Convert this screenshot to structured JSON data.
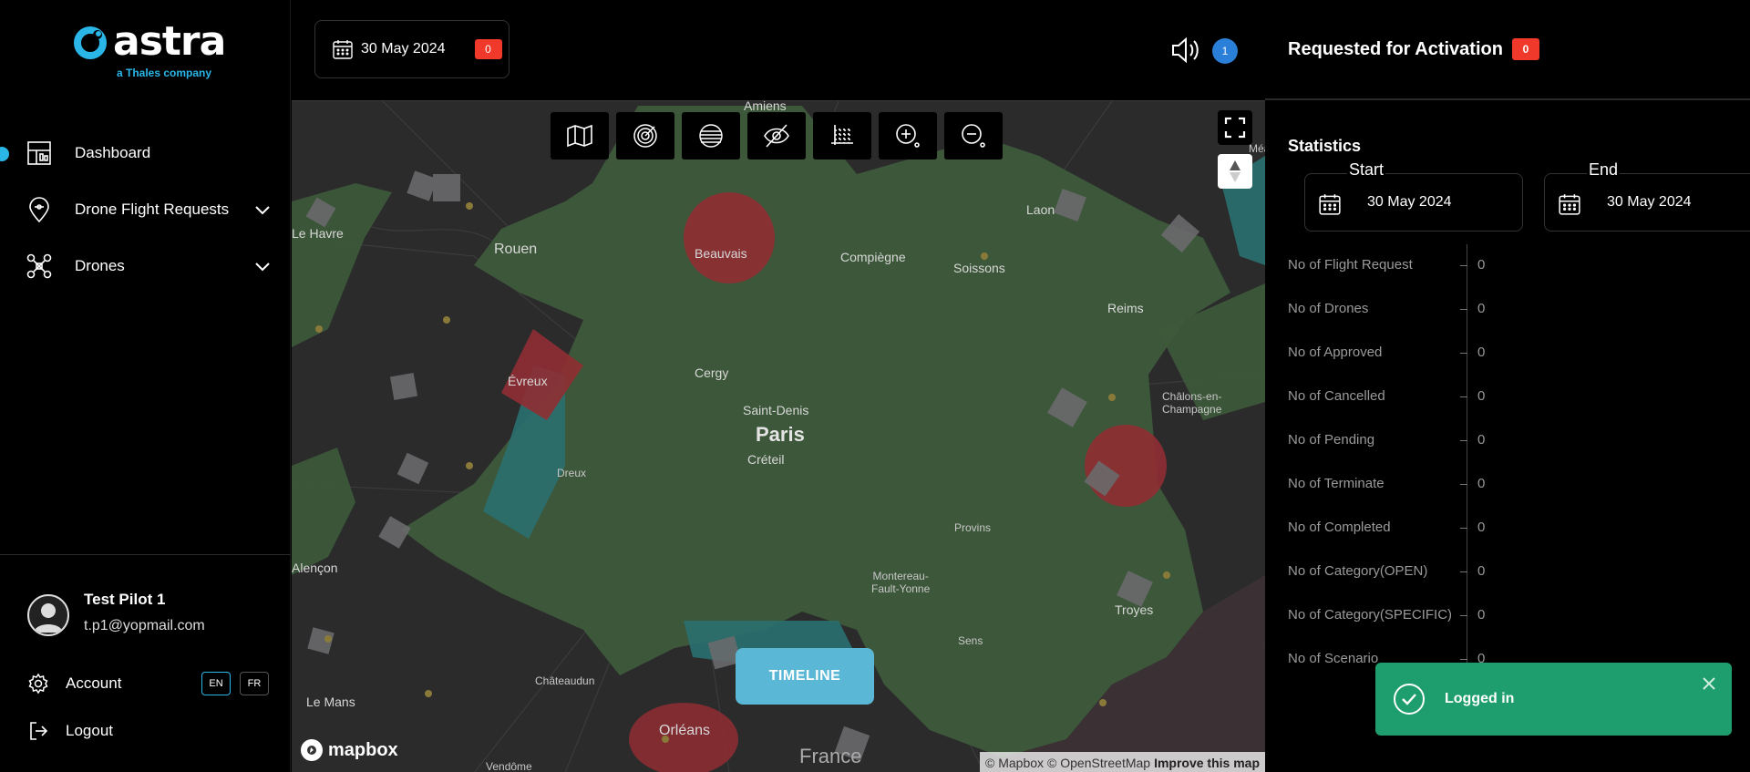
{
  "brand": {
    "name": "astra",
    "tagline": "a Thales company",
    "accent": "#2bb6e8"
  },
  "sidebar": {
    "items": [
      {
        "label": "Dashboard",
        "icon": "dashboard-icon",
        "active": true
      },
      {
        "label": "Drone Flight Requests",
        "icon": "drone-pin-icon",
        "expandable": true
      },
      {
        "label": "Drones",
        "icon": "drone-icon",
        "expandable": true
      }
    ],
    "user": {
      "name": "Test Pilot 1",
      "email": "t.p1@yopmail.com"
    },
    "account_label": "Account",
    "languages": [
      "EN",
      "FR"
    ],
    "active_language": "EN",
    "logout_label": "Logout"
  },
  "header": {
    "date": "30 May 2024",
    "date_count": "0",
    "notification_count": "1",
    "requested_title": "Requested for Activation",
    "requested_count": "0"
  },
  "map": {
    "toolbar": [
      "map-layers-icon",
      "radar-icon",
      "zones-icon",
      "hide-icon",
      "grid-icon",
      "zoom-in-icon",
      "zoom-out-icon"
    ],
    "cities": {
      "amiens": "Amiens",
      "le_havre": "Le Havre",
      "rouen": "Rouen",
      "beauvais": "Beauvais",
      "compiegne": "Compiègne",
      "soissons": "Soissons",
      "laon": "Laon",
      "reims": "Reims",
      "evreux": "Évreux",
      "cergy": "Cergy",
      "saint_denis": "Saint-Denis",
      "paris": "Paris",
      "creteil": "Créteil",
      "dreux": "Dreux",
      "chalons": "Châlons-en-\nChampagne",
      "provins": "Provins",
      "alencon": "Alençon",
      "montereau": "Montereau-\nFault-Yonne",
      "troyes": "Troyes",
      "sens": "Sens",
      "chateaudun": "Châteaudun",
      "le_mans": "Le Mans",
      "orleans": "Orléans",
      "france": "France",
      "vendome": "Vendôme",
      "meaux_edge": "Méa"
    },
    "timeline_label": "TIMELINE",
    "mapbox_label": "mapbox",
    "attribution": {
      "mapbox": "© Mapbox",
      "osm": "© OpenStreetMap",
      "improve": "Improve this map"
    }
  },
  "stats": {
    "title": "Statistics",
    "start_label": "Start",
    "end_label": "End",
    "start_date": "30 May 2024",
    "end_date": "30 May 2024",
    "rows": [
      {
        "label": "No of Flight Request",
        "value": "0"
      },
      {
        "label": "No of Drones",
        "value": "0"
      },
      {
        "label": "No of Approved",
        "value": "0"
      },
      {
        "label": "No of Cancelled",
        "value": "0"
      },
      {
        "label": "No of Pending",
        "value": "0"
      },
      {
        "label": "No of Terminate",
        "value": "0"
      },
      {
        "label": "No of Completed",
        "value": "0"
      },
      {
        "label": "No of Category(OPEN)",
        "value": "0"
      },
      {
        "label": "No of Category(SPECIFIC)",
        "value": "0"
      },
      {
        "label": "No of Scenario",
        "value": "0"
      }
    ]
  },
  "toast": {
    "message": "Logged in",
    "color": "#1e9e6e"
  }
}
